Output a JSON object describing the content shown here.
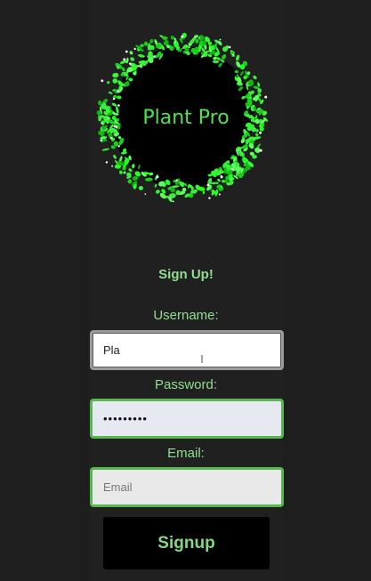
{
  "logo": {
    "text": "Plant Pro",
    "icon": "plant-wreath-icon",
    "color": "#4fe24f"
  },
  "form": {
    "heading": "Sign Up!",
    "username": {
      "label": "Username:",
      "value": "Pla"
    },
    "password": {
      "label": "Password:",
      "value": "•••••••••"
    },
    "email": {
      "label": "Email:",
      "placeholder": "Email"
    },
    "submit_label": "Signup"
  },
  "colors": {
    "background": "#1e1e1e",
    "accent_green": "#56b84f",
    "label_green": "#8fdf8f",
    "button_bg": "#000000"
  }
}
